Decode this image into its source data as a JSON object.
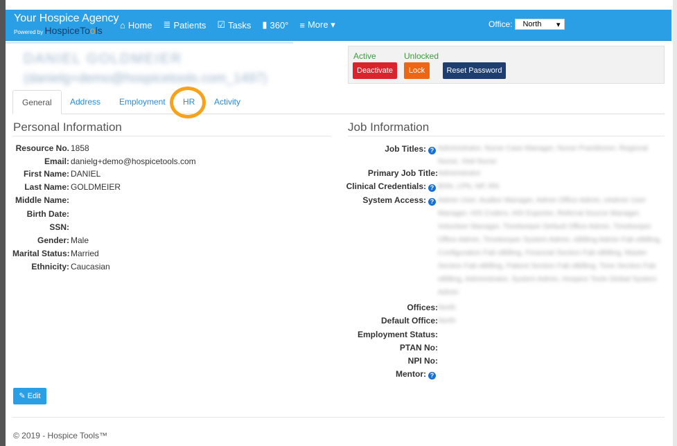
{
  "navbar": {
    "brand_title": "Your Hospice Agency",
    "brand_powered": "Powered by",
    "brand_logo_a": "HospiceTo",
    "brand_logo_oo": "o",
    "brand_logo_b": "ls",
    "items": [
      {
        "icon": "home-icon",
        "glyph": "⌂",
        "label": "Home"
      },
      {
        "icon": "list-icon",
        "glyph": "≣",
        "label": "Patients"
      },
      {
        "icon": "check-square-icon",
        "glyph": "☑",
        "label": "Tasks"
      },
      {
        "icon": "bar-chart-icon",
        "glyph": "▮",
        "label": "360°"
      },
      {
        "icon": "menu-icon",
        "glyph": "≡",
        "label": "More ▾"
      }
    ],
    "office_label": "Office:",
    "office_value": "North"
  },
  "profile": {
    "name_blurred": "DANIEL GOLDMEIER",
    "email_blurred": "(danielg+demo@hospicetools.com_1497)"
  },
  "status": {
    "active": "Active",
    "unlocked": "Unlocked",
    "deactivate": "Deactivate",
    "lock": "Lock",
    "reset_password": "Reset Password"
  },
  "tabs": [
    "General",
    "Address",
    "Employment",
    "HR",
    "Activity"
  ],
  "personal": {
    "title": "Personal Information",
    "rows": [
      {
        "label": "Resource No.",
        "value": "1858"
      },
      {
        "label": "Email:",
        "value": "danielg+demo@hospicetools.com"
      },
      {
        "label": "First Name:",
        "value": "DANIEL"
      },
      {
        "label": "Last Name:",
        "value": "GOLDMEIER"
      },
      {
        "label": "Middle Name:",
        "value": ""
      },
      {
        "label": "Birth Date:",
        "value": ""
      },
      {
        "label": "SSN:",
        "value": ""
      },
      {
        "label": "Gender:",
        "value": "Male"
      },
      {
        "label": "Marital Status:",
        "value": "Married"
      },
      {
        "label": "Ethnicity:",
        "value": "Caucasian"
      }
    ]
  },
  "job": {
    "title": "Job Information",
    "job_titles_label": "Job Titles:",
    "job_titles_value": "Administrator, Nurse Case Manager, Nurse Practitioner, Regional Nurse, Visit Nurse",
    "primary_label": "Primary Job Title:",
    "primary_value": "Administrator",
    "clinical_label": "Clinical Credentials:",
    "clinical_value": "BSN, LPN, NP, RN",
    "system_label": "System Access:",
    "system_value": "Admin User, Auditor Manager, Admin Office Admin, eAdmin User Manager, HIS Coders, HIS Exporter, Referral Source Manager, Volunteer Manager, Timekeeper Default Office Admin, Timekeeper Office Admin, Timekeeper System Admin, eBilling Admin Fab eBilling, Configuration Fab eBilling, Financial Section Fab eBilling, Master Section Fab eBilling, Patient Section Fab eBilling, Time Section Fab eBilling, Administrator, System Admin, Hospice Tools Global System Admin",
    "offices_label": "Offices:",
    "offices_value": "North",
    "default_office_label": "Default Office:",
    "default_office_value": "North",
    "employment_status_label": "Employment Status:",
    "ptan_label": "PTAN No:",
    "npi_label": "NPI No:",
    "mentor_label": "Mentor:"
  },
  "edit_label": "Edit",
  "footer": "© 2019 - Hospice Tools™"
}
